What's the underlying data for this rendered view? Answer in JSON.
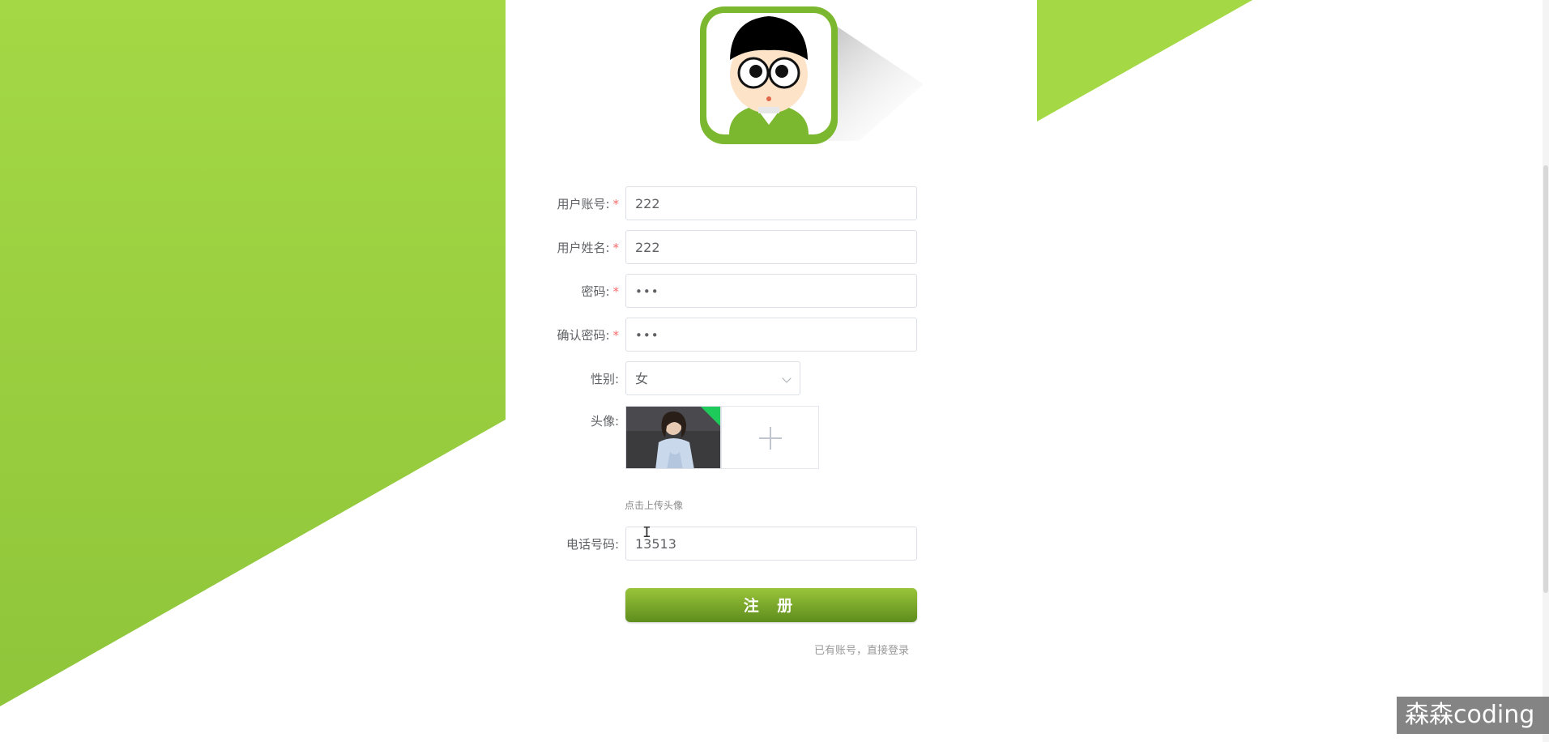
{
  "colors": {
    "accent_green": "#8dc63f",
    "required": "#f56c6c"
  },
  "form": {
    "username": {
      "label": "用户账号:",
      "required_mark": "*",
      "value": "222"
    },
    "fullname": {
      "label": "用户姓名:",
      "required_mark": "*",
      "value": "222"
    },
    "password": {
      "label": "密码:",
      "required_mark": "*",
      "value": "•••"
    },
    "confirm_password": {
      "label": "确认密码:",
      "required_mark": "*",
      "value": "•••"
    },
    "gender": {
      "label": "性别:",
      "selected": "女"
    },
    "avatar": {
      "label": "头像:",
      "hint": "点击上传头像"
    },
    "phone": {
      "label": "电话号码:",
      "value": "13513"
    }
  },
  "actions": {
    "register_label": "注 册",
    "login_link": "已有账号，直接登录"
  },
  "icons": {
    "upload": "plus-icon",
    "dropdown": "chevron-down-icon",
    "logo": "cartoon-avatar-logo"
  },
  "watermark": {
    "text": "森森coding"
  }
}
